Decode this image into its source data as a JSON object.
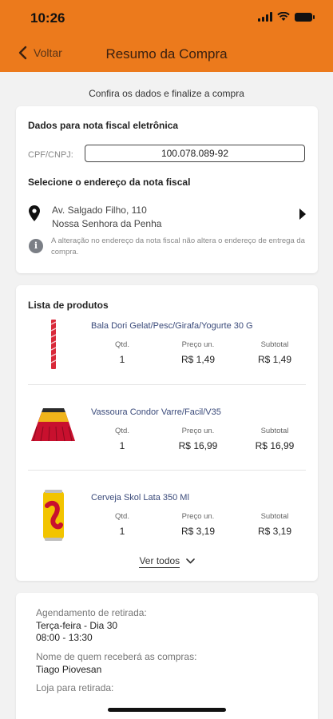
{
  "status_bar": {
    "time": "10:26"
  },
  "header": {
    "back_label": "Voltar",
    "title": "Resumo da Compra",
    "bg_color": "#ec7a1c"
  },
  "subtitle": "Confira os dados e finalize a compra",
  "nota_fiscal": {
    "heading": "Dados para nota fiscal eletrônica",
    "cpf_label": "CPF/CNPJ:",
    "cpf_value": "100.078.089-92",
    "address_heading": "Selecione o endereço da nota fiscal",
    "address_line1": "Av. Salgado Filho, 110",
    "address_line2": "Nossa Senhora da Penha",
    "info_text": "A alteração no endereço da nota fiscal não altera o endereço de entrega da compra."
  },
  "produtos": {
    "heading": "Lista de produtos",
    "columns": {
      "qty": "Qtd.",
      "price": "Preço un.",
      "subtotal": "Subtotal"
    },
    "items": [
      {
        "name": "Bala Dori Gelat/Pesc/Girafa/Yogurte 30 G",
        "qty": "1",
        "price": "R$ 1,49",
        "subtotal": "R$ 1,49",
        "image_icon": "candy-stick-icon"
      },
      {
        "name": "Vassoura Condor Varre/Facil/V35",
        "qty": "1",
        "price": "R$ 16,99",
        "subtotal": "R$ 16,99",
        "image_icon": "broom-icon"
      },
      {
        "name": "Cerveja Skol Lata 350 Ml",
        "qty": "1",
        "price": "R$ 3,19",
        "subtotal": "R$ 3,19",
        "image_icon": "beer-can-icon"
      }
    ],
    "ver_todos": "Ver todos"
  },
  "retirada": {
    "agendamento_label": "Agendamento de retirada:",
    "dia": "Terça-feira - Dia 30",
    "horario": "08:00 - 13:30",
    "recebedor_label": "Nome de quem receberá as compras:",
    "recebedor": "Tiago Piovesan",
    "loja_label": "Loja para retirada:"
  }
}
